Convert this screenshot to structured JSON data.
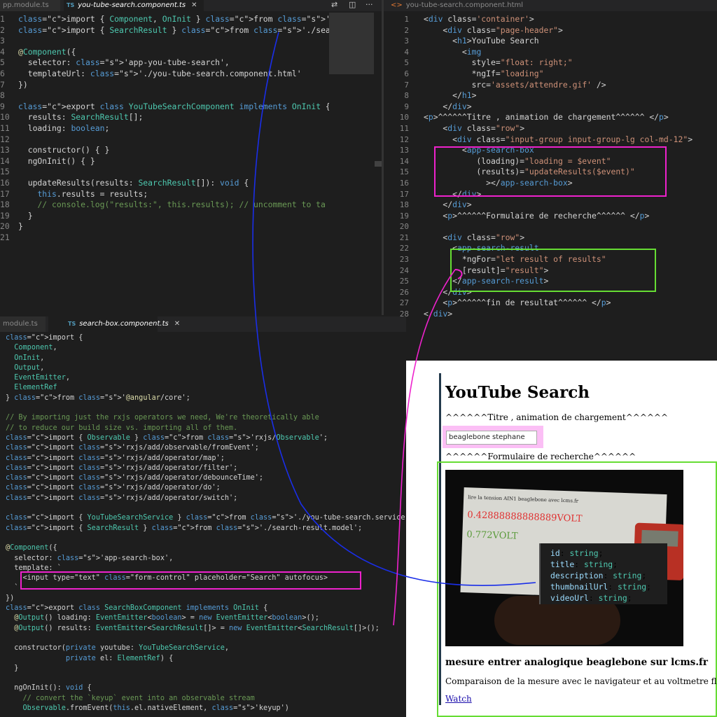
{
  "top_left": {
    "tabs": [
      {
        "label": "pp.module.ts",
        "active": false
      },
      {
        "label": "you-tube-search.component.ts",
        "active": true
      }
    ],
    "lines": [
      "import { Component, OnInit } from '@angular/core';",
      "import { SearchResult } from './search-result.model';",
      "",
      "@Component({",
      "  selector: 'app-you-tube-search',",
      "  templateUrl: './you-tube-search.component.html'",
      "})",
      "",
      "export class YouTubeSearchComponent implements OnInit {",
      "  results: SearchResult[];",
      "  loading: boolean;",
      "",
      "  constructor() { }",
      "  ngOnInit() { }",
      "",
      "  updateResults(results: SearchResult[]): void {",
      "    this.results = results;",
      "    // console.log(\"results:\", this.results); // uncomment to ta",
      "  }",
      "}",
      ""
    ],
    "line_numbers": [
      "1",
      "2",
      "3",
      "4",
      "5",
      "6",
      "7",
      "8",
      "9",
      "10",
      "11",
      "12",
      "13",
      "14",
      "15",
      "16",
      "17",
      "18",
      "19",
      "20",
      "21"
    ]
  },
  "top_right": {
    "tabs": [
      {
        "label": "you-tube-search.component.html",
        "active": false
      }
    ],
    "lines": [
      "<div class='container'>",
      "    <div class=\"page-header\">",
      "      <h1>YouTube Search",
      "        <img",
      "          style=\"float: right;\"",
      "          *ngIf=\"loading\"",
      "          src='assets/attendre.gif' />",
      "      </h1>",
      "    </div>",
      "<p>^^^^^^Titre , animation de chargement^^^^^^ </p>",
      "    <div class=\"row\">",
      "      <div class=\"input-group input-group-lg col-md-12\">",
      "        <app-search-box",
      "           (loading)=\"loading = $event\"",
      "           (results)=\"updateResults($event)\"",
      "             ></app-search-box>",
      "      </div>",
      "    </div>",
      "    <p>^^^^^^Formulaire de recherche^^^^^^ </p>",
      "",
      "    <div class=\"row\">",
      "      <app-search-result",
      "        *ngFor=\"let result of results\"",
      "        [result]=\"result\">",
      "      </app-search-result>",
      "    </div>",
      "    <p>^^^^^^fin de resultat^^^^^^ </p>",
      "</div>"
    ],
    "line_numbers": [
      "1",
      "2",
      "3",
      "4",
      "5",
      "6",
      "7",
      "8",
      "9",
      "10",
      "11",
      "12",
      "13",
      "14",
      "15",
      "16",
      "17",
      "18",
      "19",
      "20",
      "21",
      "22",
      "23",
      "24",
      "25",
      "26",
      "27",
      "28"
    ]
  },
  "bottom": {
    "tabs": [
      {
        "label": "module.ts",
        "active": false
      },
      {
        "label": "search-box.component.ts",
        "active": true
      }
    ],
    "lines": [
      "import {",
      "  Component,",
      "  OnInit,",
      "  Output,",
      "  EventEmitter,",
      "  ElementRef",
      "} from '@angular/core';",
      "",
      "// By importing just the rxjs operators we need, We're theoretically able",
      "// to reduce our build size vs. importing all of them.",
      "import { Observable } from 'rxjs/Observable';",
      "import 'rxjs/add/observable/fromEvent';",
      "import 'rxjs/add/operator/map';",
      "import 'rxjs/add/operator/filter';",
      "import 'rxjs/add/operator/debounceTime';",
      "import 'rxjs/add/operator/do';",
      "import 'rxjs/add/operator/switch';",
      "",
      "import { YouTubeSearchService } from './you-tube-search.service';",
      "import { SearchResult } from './search-result.model';",
      "",
      "@Component({",
      "  selector: 'app-search-box',",
      "  template: `",
      "    <input type=\"text\" class=\"form-control\" placeholder=\"Search\" autofocus>",
      "  `",
      "})",
      "export class SearchBoxComponent implements OnInit {",
      "  @Output() loading: EventEmitter<boolean> = new EventEmitter<boolean>();",
      "  @Output() results: EventEmitter<SearchResult[]> = new EventEmitter<SearchResult[]>();",
      "",
      "  constructor(private youtube: YouTubeSearchService,",
      "              private el: ElementRef) {",
      "  }",
      "",
      "  ngOnInit(): void {",
      "    // convert the `keyup` event into an observable stream",
      "    Observable.fromEvent(this.el.nativeElement, 'keyup')"
    ]
  },
  "browser": {
    "title": "YouTube Search",
    "para_loading": "^^^^^^Titre , animation de chargement^^^^^^",
    "search_value": "beaglebone stephane",
    "para_form": "^^^^^^Formulaire de recherche^^^^^^",
    "thumbnail": {
      "header": "lire la tension AIN1 beaglebone avec lcms.fr",
      "value1": "0.42888888888889VOLT",
      "value2": "0.772VOLT"
    },
    "result_title": "mesure entrer analogique beaglebone sur lcms.fr",
    "result_description": "Comparaison de la mesure avec le navigateur et au voltmetre fluke.",
    "watch_label": "Watch"
  },
  "model_popup": {
    "lines": [
      "  id: string;",
      "  title: string;",
      "  description: string;",
      "  thumbnailUrl: string;",
      "  videoUrl: string;"
    ]
  },
  "colors": {
    "magenta_highlight": "#ee22cc",
    "green_highlight": "#66dd33",
    "blue_connector": "#1a2ee8",
    "editor_bg": "#1e1e1e"
  },
  "icons": [
    "compare-icon",
    "split-editor-icon",
    "more-icon",
    "close-icon"
  ]
}
